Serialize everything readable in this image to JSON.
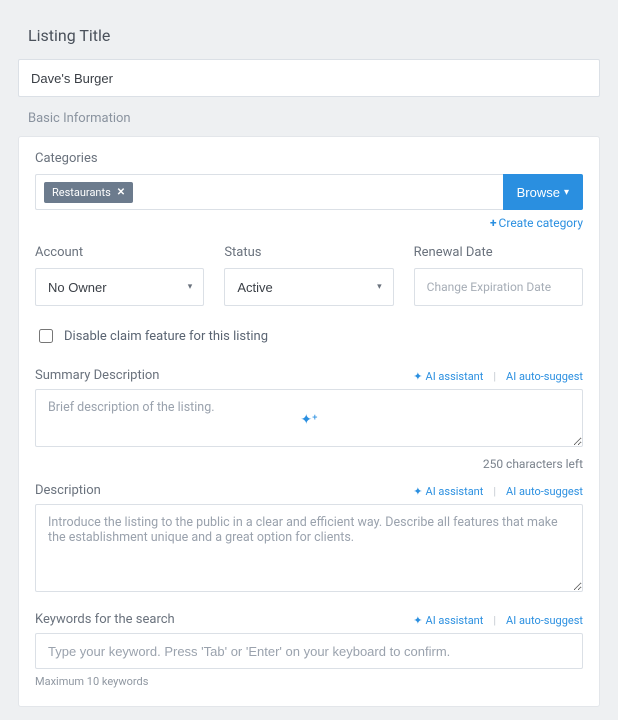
{
  "listing": {
    "title_label": "Listing Title",
    "title_value": "Dave's Burger"
  },
  "basic_info": {
    "heading": "Basic Information",
    "categories": {
      "label": "Categories",
      "tags": [
        {
          "label": "Restaurants"
        }
      ],
      "browse_label": "Browse",
      "create_label": "Create category"
    },
    "account": {
      "label": "Account",
      "value": "No Owner"
    },
    "status": {
      "label": "Status",
      "value": "Active"
    },
    "renewal": {
      "label": "Renewal Date",
      "placeholder": "Change Expiration Date"
    },
    "disable_claim": {
      "label": "Disable claim feature for this listing",
      "checked": false
    },
    "summary": {
      "label": "Summary Description",
      "placeholder": "Brief description of the listing.",
      "chars_left": "250 characters left"
    },
    "description": {
      "label": "Description",
      "placeholder": "Introduce the listing to the public in a clear and efficient way. Describe all features that make the establishment unique and a great option for clients."
    },
    "keywords": {
      "label": "Keywords for the search",
      "placeholder": "Type your keyword. Press 'Tab' or 'Enter' on your keyboard to confirm.",
      "hint": "Maximum 10 keywords"
    },
    "ai": {
      "assistant_label": "AI assistant",
      "auto_suggest_label": "AI auto-suggest"
    }
  }
}
